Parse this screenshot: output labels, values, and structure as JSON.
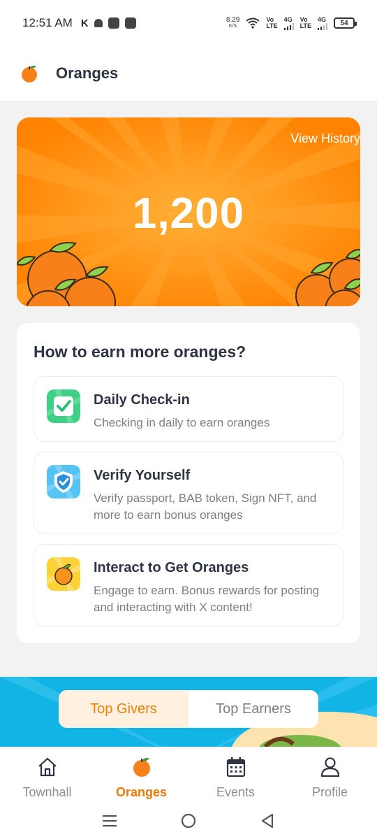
{
  "status_bar": {
    "time": "12:51 AM",
    "net_speed": "8.29",
    "net_unit": "K/S",
    "sim1_top": "Vo",
    "sim1_bottom": "LTE",
    "sim1_type": "4G",
    "sim2_top": "Vo",
    "sim2_bottom": "LTE",
    "sim2_type": "4G",
    "battery": "54"
  },
  "header": {
    "title": "Oranges",
    "icon": "orange-icon"
  },
  "balance": {
    "view_history_label": "View History",
    "value": "1,200"
  },
  "earn": {
    "title": "How to earn more oranges?",
    "items": [
      {
        "title": "Daily Check-in",
        "description": "Checking in daily to earn oranges",
        "icon": "check-icon",
        "color": "#3fcf86"
      },
      {
        "title": "Verify Yourself",
        "description": "Verify passport, BAB token, Sign NFT, and more to earn bonus oranges",
        "icon": "shield-check-icon",
        "color": "#56c3f5"
      },
      {
        "title": "Interact to Get Oranges",
        "description": "Engage to earn. Bonus rewards for posting and interacting with X content!",
        "icon": "orange-icon",
        "color": "#ffd23a"
      }
    ]
  },
  "leaderboard": {
    "tabs": [
      {
        "label": "Top Givers",
        "active": true
      },
      {
        "label": "Top Earners",
        "active": false
      }
    ]
  },
  "bottom_nav": [
    {
      "label": "Townhall",
      "icon": "home-icon",
      "active": false
    },
    {
      "label": "Oranges",
      "icon": "orange-icon",
      "active": true
    },
    {
      "label": "Events",
      "icon": "calendar-icon",
      "active": false
    },
    {
      "label": "Profile",
      "icon": "user-icon",
      "active": false
    }
  ],
  "colors": {
    "accent": "#f07a00",
    "card": "#ff8a00",
    "banner": "#12b4e6"
  }
}
